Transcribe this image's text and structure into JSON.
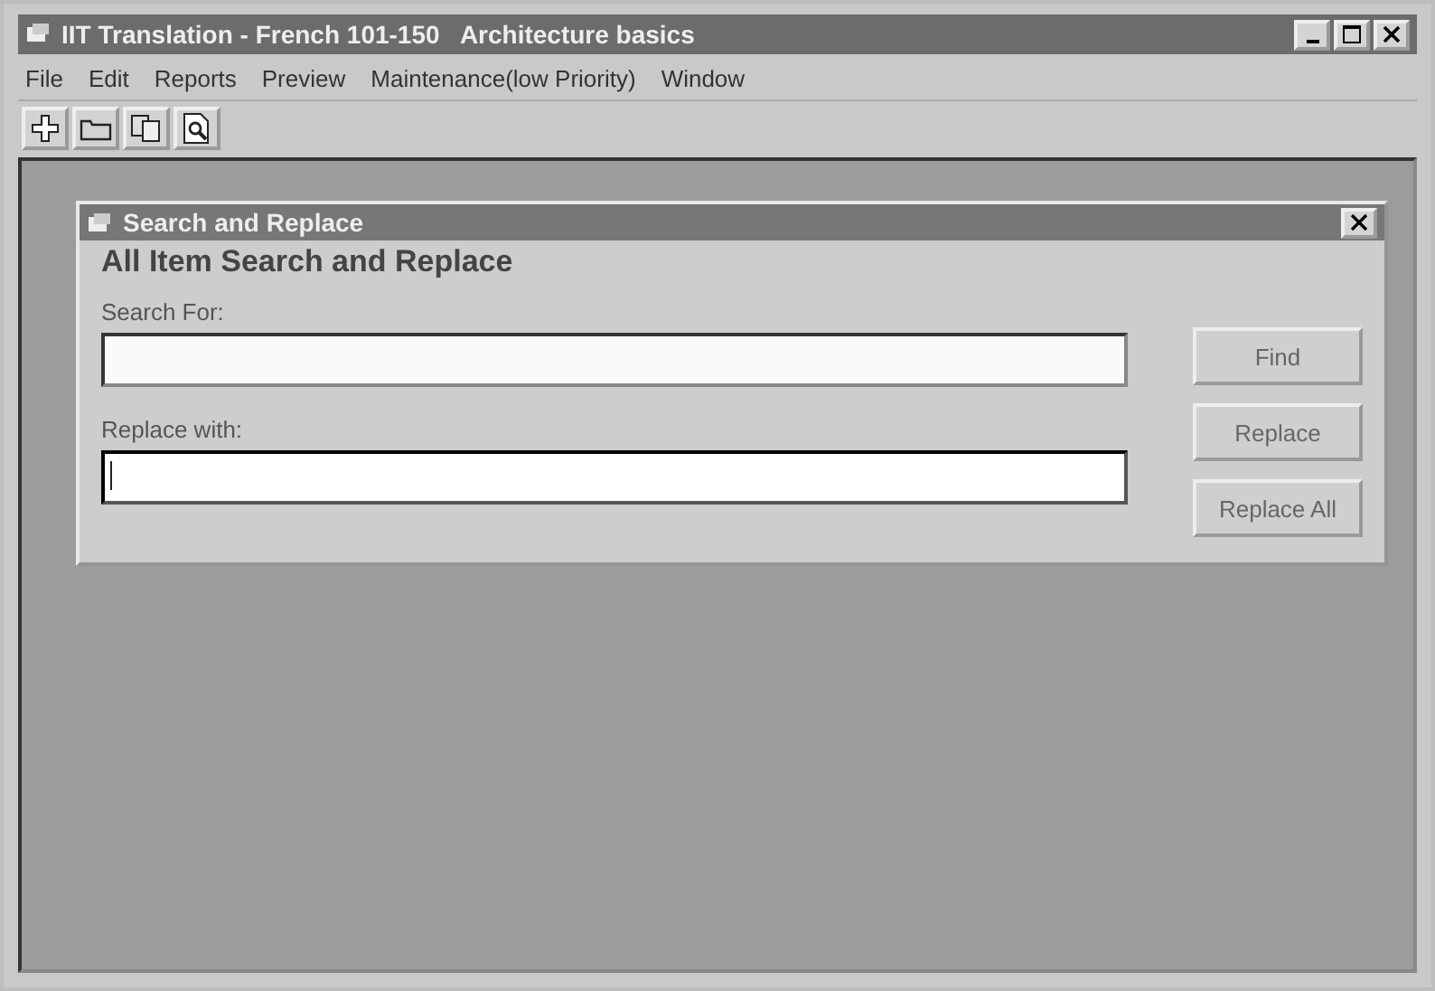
{
  "window": {
    "title": "IIT Translation - French 101-150   Architecture basics"
  },
  "menu": [
    "File",
    "Edit",
    "Reports",
    "Preview",
    "Maintenance(low Priority)",
    "Window"
  ],
  "toolbar": [
    {
      "kind": "plus"
    },
    {
      "kind": "folder"
    },
    {
      "kind": "copy"
    },
    {
      "kind": "preview"
    }
  ],
  "dialog": {
    "title": "Search and Replace",
    "heading": "All Item Search and Replace",
    "fields": [
      {
        "label": "Search For:",
        "focused": false
      },
      {
        "label": "Replace with:",
        "focused": true
      }
    ],
    "buttons": [
      "Find",
      "Replace",
      "Replace All"
    ]
  }
}
